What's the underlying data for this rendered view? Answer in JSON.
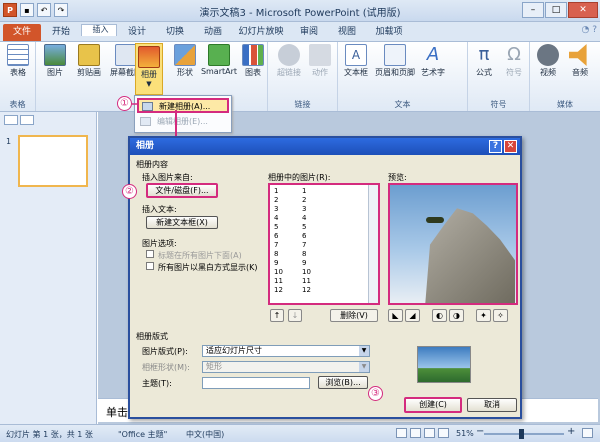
{
  "window": {
    "title": "演示文稿3 - Microsoft PowerPoint (试用版)"
  },
  "tabs": [
    {
      "label": "文件",
      "state": "file"
    },
    {
      "label": "开始",
      "state": "normal"
    },
    {
      "label": "插入",
      "state": "selected"
    },
    {
      "label": "设计",
      "state": "normal"
    },
    {
      "label": "切换",
      "state": "normal"
    },
    {
      "label": "动画",
      "state": "normal"
    },
    {
      "label": "幻灯片放映",
      "state": "normal"
    },
    {
      "label": "审阅",
      "state": "normal"
    },
    {
      "label": "视图",
      "state": "normal"
    },
    {
      "label": "加载项",
      "state": "normal"
    }
  ],
  "ribbon": {
    "groups": {
      "table": "表格",
      "images": "图像",
      "links": "链接",
      "text": "文本",
      "symbols": "符号",
      "media": "媒体"
    },
    "buttons": {
      "table": "表格",
      "picture": "图片",
      "clipart": "剪贴画",
      "screenshot": "屏幕截图",
      "album": "相册",
      "shapes": "形状",
      "smartart": "SmartArt",
      "chart": "图表",
      "hyperlink": "超链接",
      "action": "动作",
      "textbox": "文本框",
      "headerfooter": "页眉和页脚",
      "wordart": "艺术字",
      "formula": "公式",
      "symbol": "符号",
      "video": "视频",
      "audio": "音频"
    }
  },
  "album_menu": {
    "new_album": "新建相册(A)...",
    "edit_album": "编辑相册(E)..."
  },
  "slides": {
    "thumb_number": "1",
    "click_prompt": "单击此"
  },
  "dialog": {
    "title": "相册",
    "album_content": "相册内容",
    "insert_picture_from": "插入图片来自:",
    "file_disk_button": "文件/磁盘(F)...",
    "insert_text": "插入文本:",
    "new_textbox_button": "新建文本框(X)",
    "picture_options": "图片选项:",
    "caption_below_all": "标题在所有图片下面(A)",
    "all_black_white": "所有图片以黑白方式显示(K)",
    "pictures_in_album": "相册中的图片(R):",
    "preview": "预览:",
    "picture_rows": [
      "1",
      "2",
      "3",
      "4",
      "5",
      "6",
      "7",
      "8",
      "9",
      "10",
      "11",
      "12"
    ],
    "move_up": "↑",
    "move_down": "↓",
    "delete_button": "删除(V)",
    "album_layout": "相册版式",
    "picture_layout_label": "图片版式(P):",
    "picture_layout_value": "适应幻灯片尺寸",
    "frame_shape_label": "相框形状(M):",
    "frame_shape_value": "矩形",
    "theme_label": "主题(T):",
    "browse_button": "浏览(B)...",
    "create_button": "创建(C)",
    "cancel_button": "取消"
  },
  "annotations": {
    "step1": "①",
    "step2": "②",
    "step3": "③"
  },
  "status": {
    "slide_info": "幻灯片 第 1 张，共 1 张",
    "theme": "\"Office 主题\"",
    "language": "中文(中国)",
    "zoom": "51%"
  },
  "colors": {
    "highlight": "#d42b7e",
    "file_tab": "#d2552a",
    "dialog_title": "#2d6be0"
  }
}
